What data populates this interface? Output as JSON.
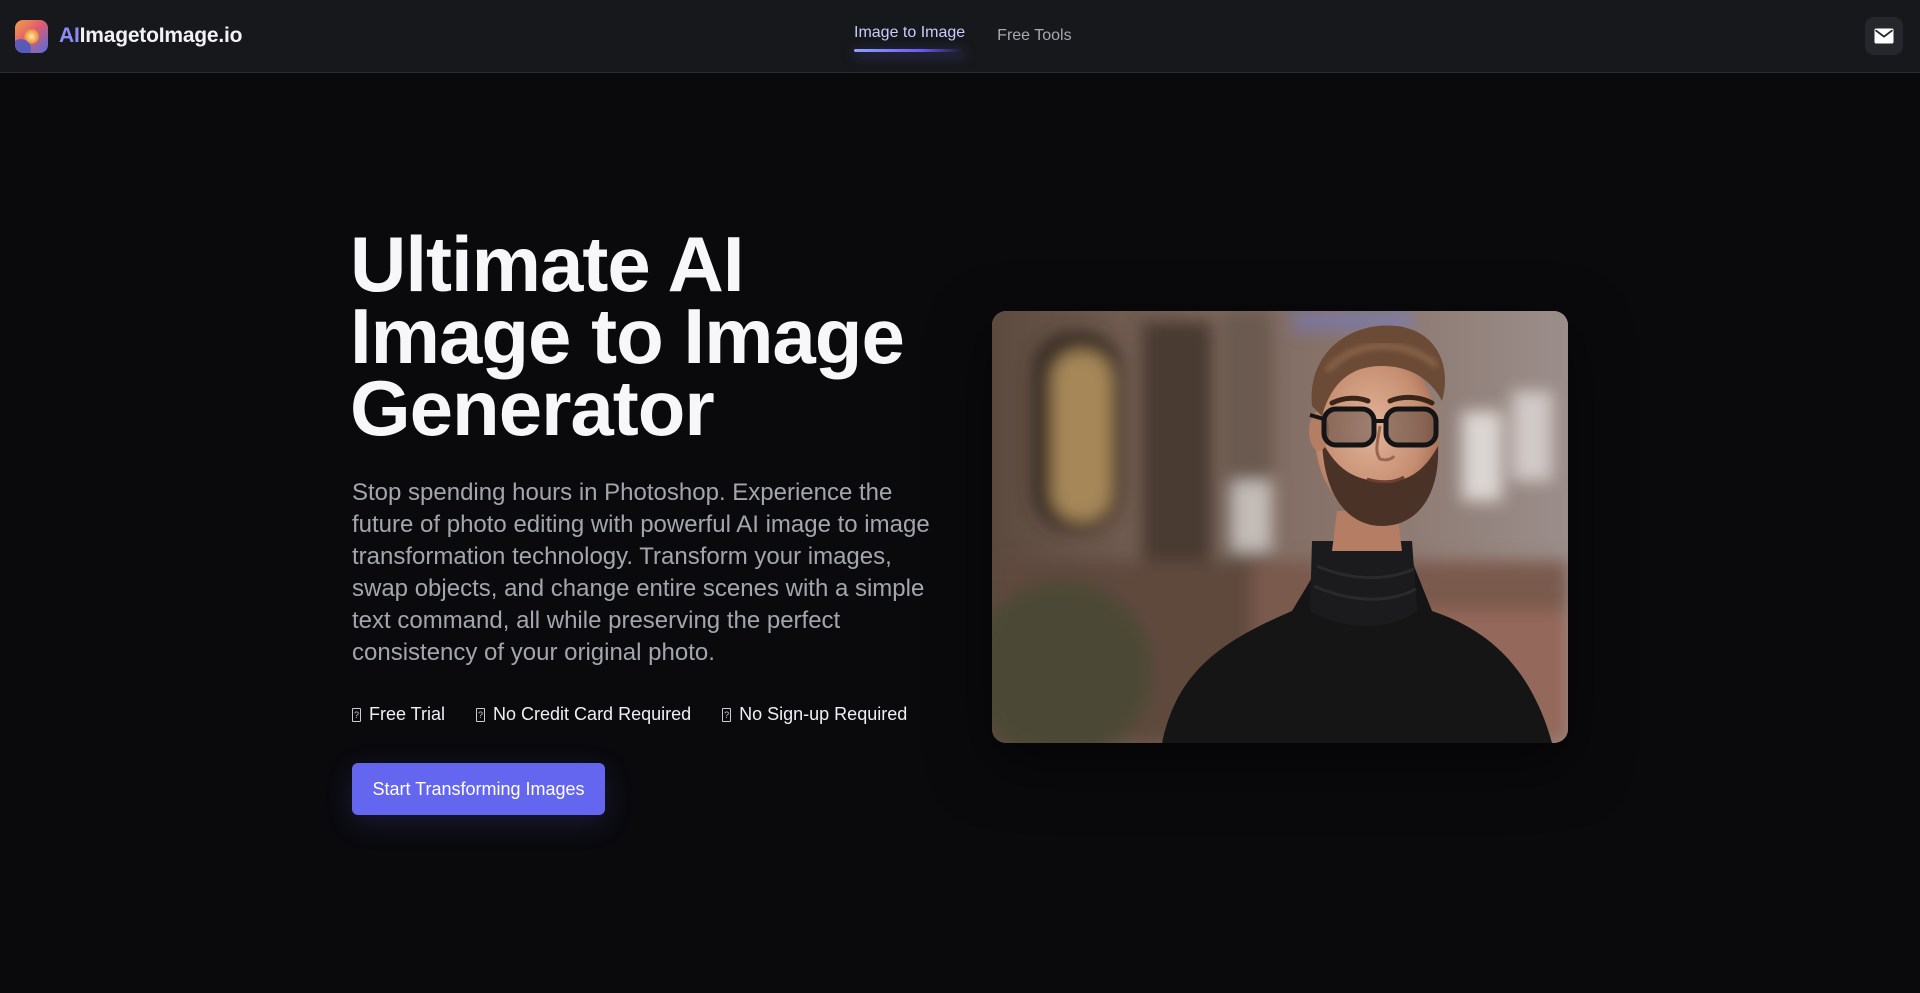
{
  "header": {
    "brand": {
      "prefix": "AI",
      "name": "ImagetoImage.io"
    },
    "nav": [
      {
        "label": "Image to Image",
        "active": true
      },
      {
        "label": "Free Tools",
        "active": false
      }
    ],
    "contact_icon": "mail-icon"
  },
  "hero": {
    "title_lines": [
      "Ultimate AI",
      "Image to Image",
      "Generator"
    ],
    "subtitle": "Stop spending hours in Photoshop. Experience the future of photo editing with powerful AI image to image transformation technology. Transform your images, swap objects, and change entire scenes with a simple text command, all while preserving the perfect consistency of your original photo.",
    "features": [
      {
        "mark": "?",
        "label": "Free Trial"
      },
      {
        "mark": "?",
        "label": "No Credit Card Required"
      },
      {
        "mark": "?",
        "label": "No Sign-up Required"
      }
    ],
    "cta_label": "Start Transforming Images",
    "image": "man-in-black-turtleneck-photo"
  },
  "colors": {
    "background": "#0a0a0d",
    "header": "#17181b",
    "accent": "#6466f0",
    "brand_ai": "#8b8df7"
  }
}
